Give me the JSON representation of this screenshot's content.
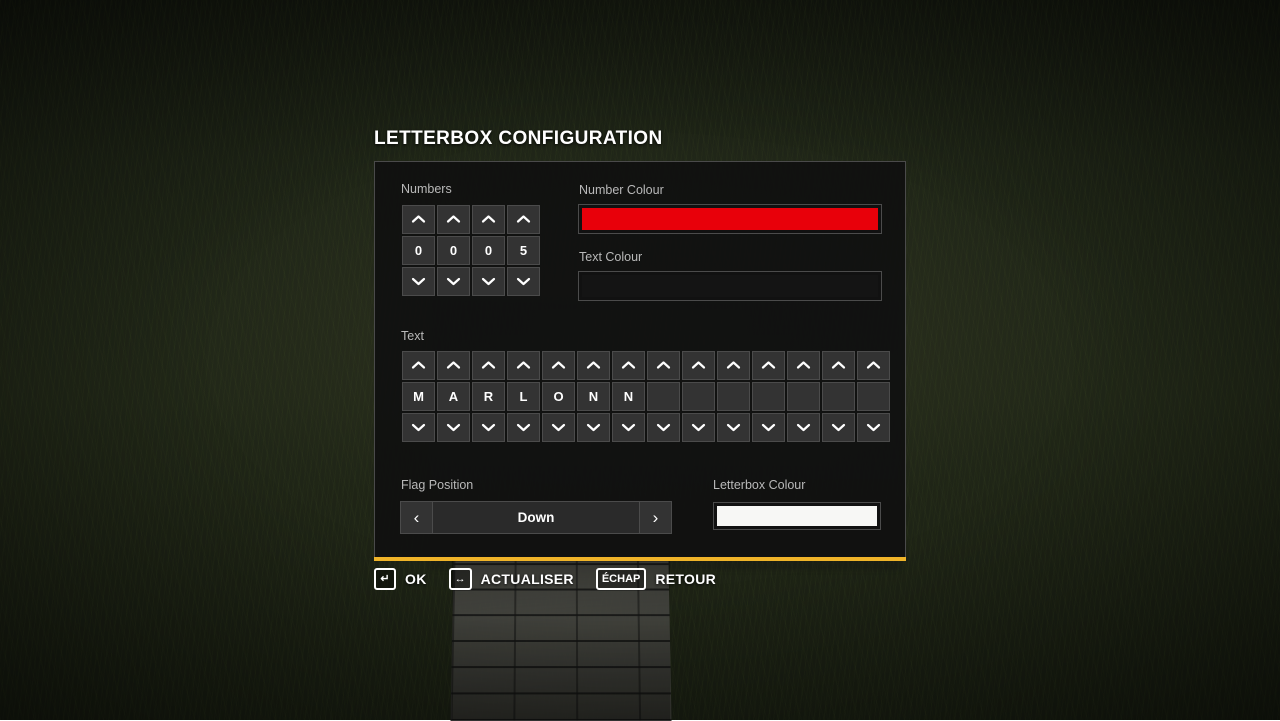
{
  "dialog": {
    "title": "LETTERBOX CONFIGURATION",
    "accent_color": "#f0b429"
  },
  "numbers_section": {
    "label": "Numbers",
    "up_icon": "chevron-up-icon",
    "down_icon": "chevron-down-icon",
    "digits": [
      "0",
      "0",
      "0",
      "5"
    ]
  },
  "number_colour": {
    "label": "Number Colour",
    "value": "#e8000a"
  },
  "text_colour": {
    "label": "Text Colour",
    "value": "#141414"
  },
  "text_section": {
    "label": "Text",
    "up_icon": "chevron-up-icon",
    "down_icon": "chevron-down-icon",
    "characters": [
      "M",
      "A",
      "R",
      "L",
      "O",
      "N",
      "N",
      "",
      "",
      "",
      "",
      "",
      "",
      ""
    ]
  },
  "flag_position": {
    "label": "Flag Position",
    "value": "Down",
    "prev_icon": "chevron-left-icon",
    "prev_glyph": "‹",
    "next_icon": "chevron-right-icon",
    "next_glyph": "›"
  },
  "letterbox_colour": {
    "label": "Letterbox Colour",
    "value": "#f7f7f5"
  },
  "footer": {
    "hints": [
      {
        "key": "↵",
        "key_icon": "enter-key-icon",
        "label": "OK"
      },
      {
        "key": "↔",
        "key_icon": "left-right-arrow-key-icon",
        "label": "ACTUALISER"
      },
      {
        "key": "ÉCHAP",
        "key_icon": "escape-key-icon",
        "label": "RETOUR"
      }
    ]
  }
}
